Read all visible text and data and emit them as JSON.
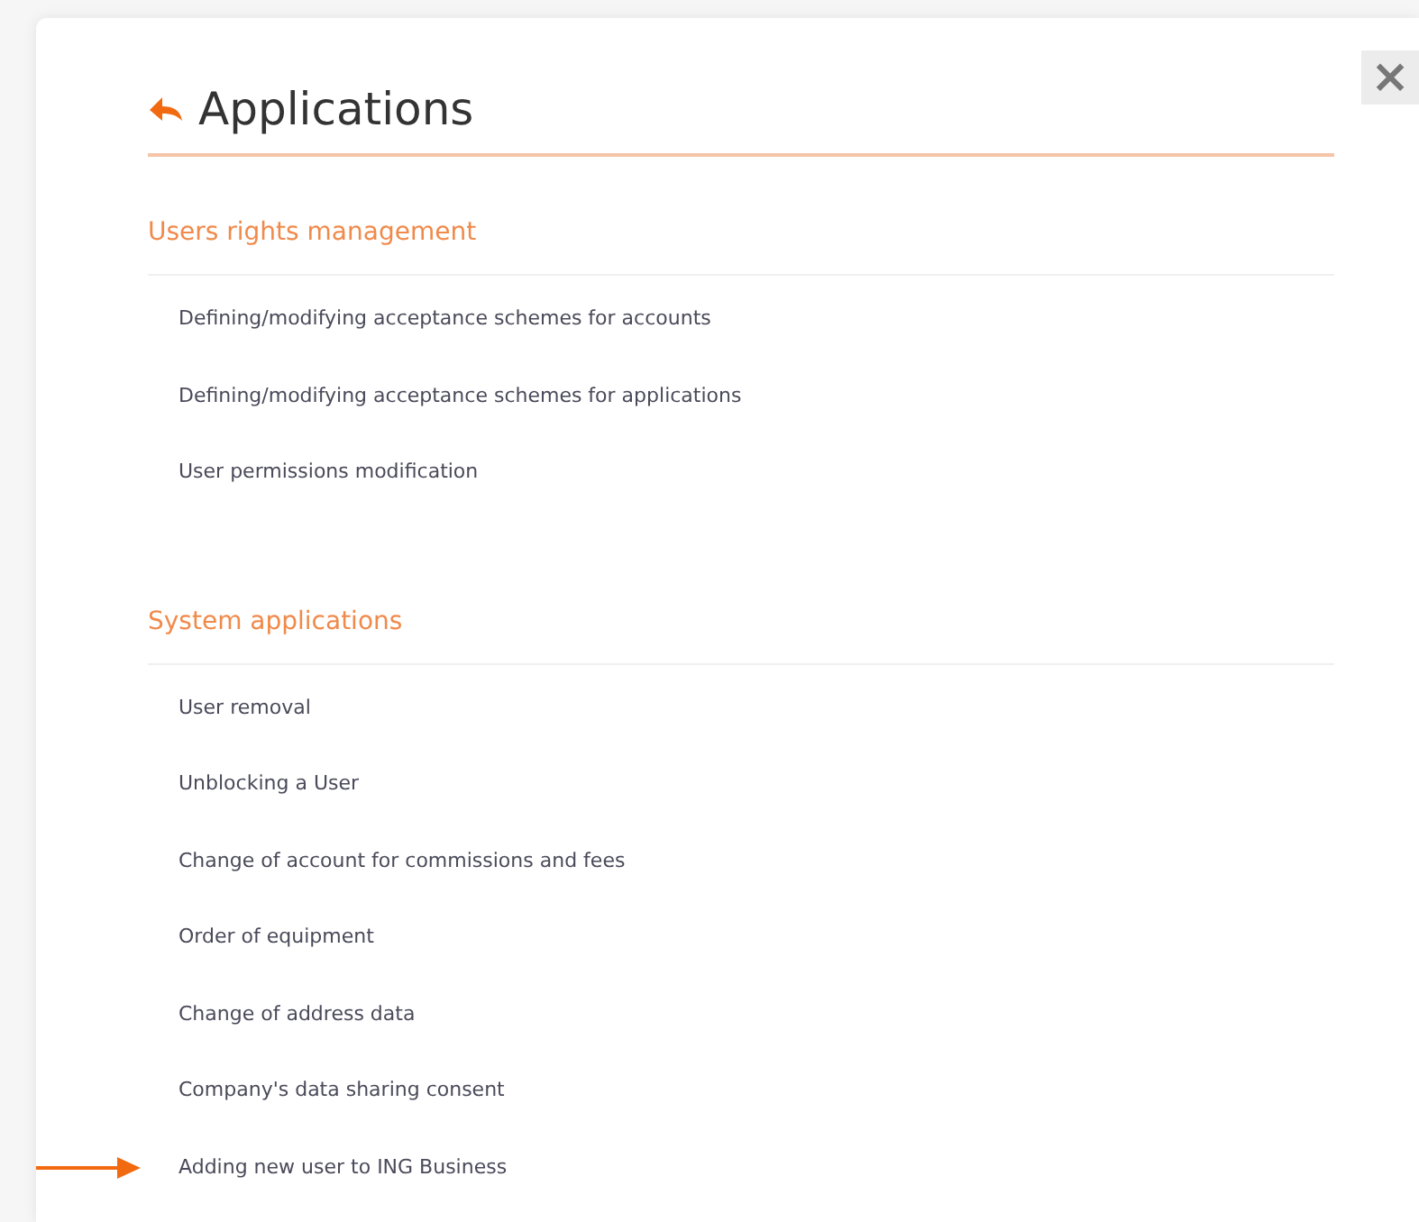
{
  "close_button": {
    "label": "×"
  },
  "title": "Applications",
  "sections": [
    {
      "heading": "Users rights management",
      "items": [
        {
          "label": "Defining/modifying acceptance schemes for accounts",
          "marked": false
        },
        {
          "label": "Defining/modifying acceptance schemes for applications",
          "marked": false
        },
        {
          "label": "User permissions modification",
          "marked": false
        }
      ]
    },
    {
      "heading": "System applications",
      "items": [
        {
          "label": "User removal",
          "marked": false
        },
        {
          "label": "Unblocking a User",
          "marked": false
        },
        {
          "label": "Change of account for commissions and fees",
          "marked": false
        },
        {
          "label": "Order of equipment",
          "marked": false
        },
        {
          "label": "Change of address data",
          "marked": false
        },
        {
          "label": "Company's data sharing consent",
          "marked": false
        },
        {
          "label": "Adding new user to ING Business",
          "marked": true
        }
      ]
    }
  ]
}
